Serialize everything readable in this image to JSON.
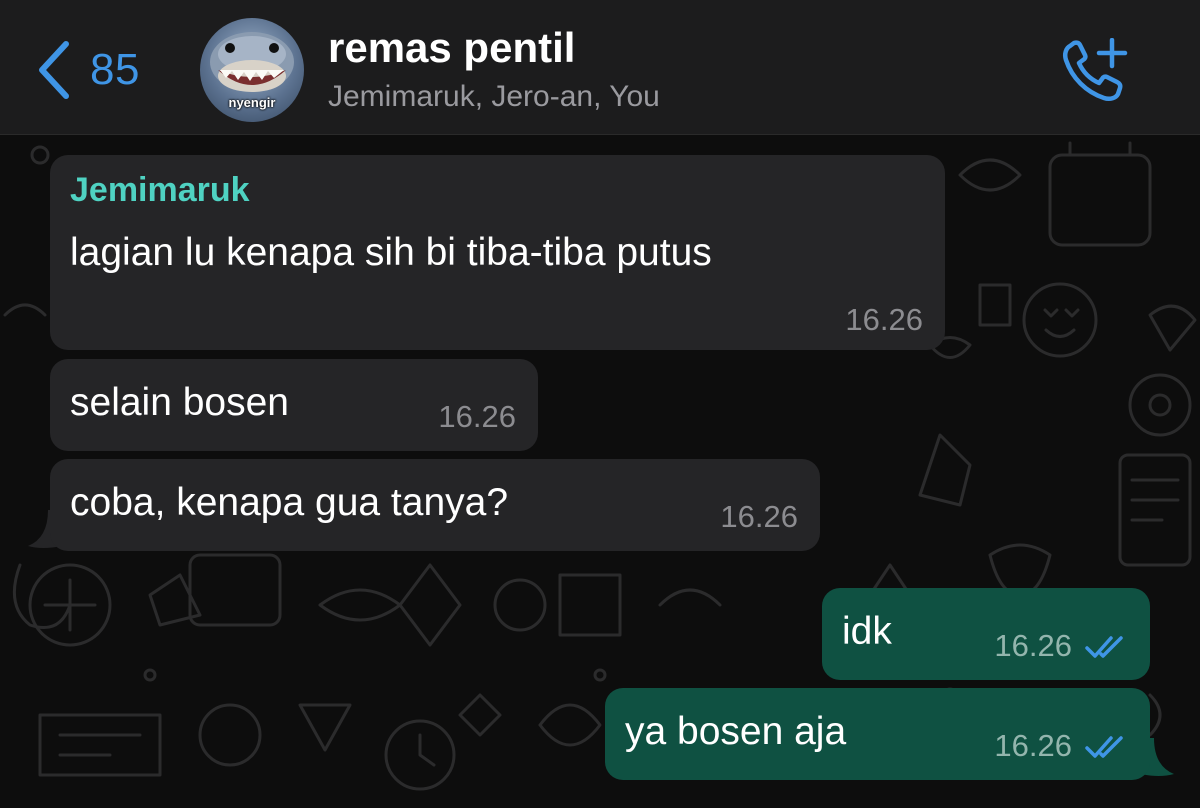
{
  "header": {
    "back_count": "85",
    "avatar_caption": "nyengir",
    "title": "remas pentil",
    "subtitle": "Jemimaruk, Jero-an, You",
    "call_icon": "add-call-icon"
  },
  "colors": {
    "accent": "#3f95e6",
    "header_bg": "#1c1c1d",
    "incoming_bubble": "#252527",
    "outgoing_bubble": "#0f5142",
    "sender_name": "#4fd2c2",
    "read_ticks": "#3f95e6"
  },
  "messages": [
    {
      "direction": "incoming",
      "sender": "Jemimaruk",
      "text": "lagian lu kenapa sih bi tiba-tiba putus",
      "time": "16.26"
    },
    {
      "direction": "incoming",
      "text": "selain bosen",
      "time": "16.26"
    },
    {
      "direction": "incoming",
      "text": "coba, kenapa gua tanya?",
      "time": "16.26"
    },
    {
      "direction": "outgoing",
      "text": "idk",
      "time": "16.26",
      "status": "read"
    },
    {
      "direction": "outgoing",
      "text": "ya bosen aja",
      "time": "16.26",
      "status": "read"
    }
  ]
}
